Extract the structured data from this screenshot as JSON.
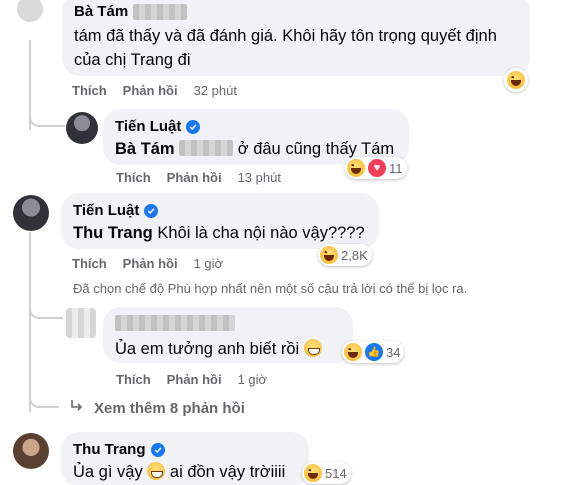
{
  "actions": {
    "like": "Thích",
    "reply": "Phản hồi"
  },
  "comments": [
    {
      "author": "Bà Tám",
      "text": "tám đã thấy và đã đánh giá. Khôi hãy tôn trọng quyết định của chị Trang đi",
      "time": "32 phút",
      "reactions": [
        "haha"
      ],
      "reaction_count": ""
    },
    {
      "author": "Tiến Luật",
      "verified": true,
      "tag": "Bà Tám",
      "text": "ở đâu cũng thấy Tám",
      "time": "13 phút",
      "reactions": [
        "haha",
        "heart"
      ],
      "reaction_count": "11"
    },
    {
      "author": "Tiến Luật",
      "verified": true,
      "tag": "Thu Trang",
      "text": "Khôi là cha nội nào vậy????",
      "time": "1 giờ",
      "reactions": [
        "haha"
      ],
      "reaction_count": "2,8K"
    },
    {
      "author": "",
      "text": "Ủa em tưởng anh biết rồi",
      "time": "1 giờ",
      "reactions": [
        "haha",
        "like"
      ],
      "reaction_count": "34"
    },
    {
      "author": "Thu Trang",
      "verified": true,
      "text_before": "Ủa gì vậy",
      "text_after": "ai đồn vậy trờiiii",
      "reactions": [
        "haha"
      ],
      "reaction_count": "514"
    }
  ],
  "filter_notice": "Đã chọn chế độ Phù hợp nhất nên một số câu trả lời có thể bị lọc ra.",
  "view_more": "Xem thêm 8 phản hồi",
  "icons": {
    "verified": "verified-badge-icon",
    "more_replies": "reply-arrow-icon",
    "reaction_haha": "haha-reaction-icon",
    "reaction_heart": "love-reaction-icon",
    "reaction_like": "like-reaction-icon"
  },
  "colors": {
    "bubble": "#f0f2f5",
    "verified": "#1877f2",
    "meta_text": "#65676b",
    "heart": "#f33e58"
  }
}
